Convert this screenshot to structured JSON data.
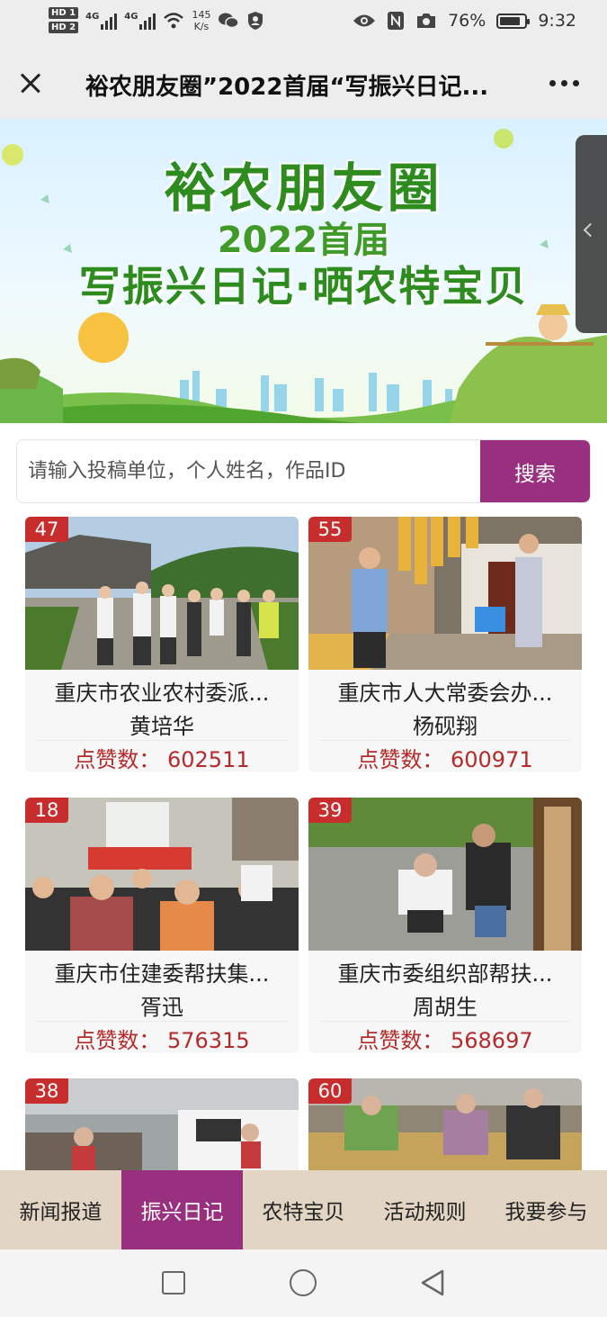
{
  "status_bar": {
    "hd1": "HD 1",
    "hd2": "HD 2",
    "net1": "4G",
    "net2": "4G",
    "speed_value": "145",
    "speed_unit": "K/s",
    "battery": "76%",
    "time": "9:32",
    "icons": [
      "wifi-icon",
      "wechat-icon",
      "shield-icon",
      "eye-icon",
      "nfc-icon",
      "camera-icon",
      "battery-icon"
    ]
  },
  "title_bar": {
    "title": "裕农朋友圈”2022首届“写振兴日记...",
    "close_icon": "close-icon",
    "more_icon": "more-icon"
  },
  "banner": {
    "line1": "裕农朋友圈",
    "line2": "2022首届",
    "line3": "写振兴日记·晒农特宝贝"
  },
  "search": {
    "placeholder": "请输入投稿单位，个人姓名，作品ID",
    "value": "",
    "button_label": "搜索"
  },
  "cards": [
    {
      "id": "47",
      "title": "重庆市农业农村委派...",
      "name": "黄培华",
      "likes": "点赞数： 602511"
    },
    {
      "id": "55",
      "title": "重庆市人大常委会办...",
      "name": "杨砚翔",
      "likes": "点赞数： 600971"
    },
    {
      "id": "18",
      "title": "重庆市住建委帮扶集...",
      "name": "胥迅",
      "likes": "点赞数： 576315"
    },
    {
      "id": "39",
      "title": "重庆市委组织部帮扶...",
      "name": "周胡生",
      "likes": "点赞数： 568697"
    },
    {
      "id": "38"
    },
    {
      "id": "60"
    }
  ],
  "tabs": [
    {
      "label": "新闻报道",
      "active": false
    },
    {
      "label": "振兴日记",
      "active": true
    },
    {
      "label": "农特宝贝",
      "active": false
    },
    {
      "label": "活动规则",
      "active": false
    },
    {
      "label": "我要参与",
      "active": false
    }
  ],
  "colors": {
    "accent": "#98307f",
    "badge": "#c82d2d",
    "likes_text": "#b42b2b",
    "tab_bar_bg": "#e3d5c4"
  }
}
